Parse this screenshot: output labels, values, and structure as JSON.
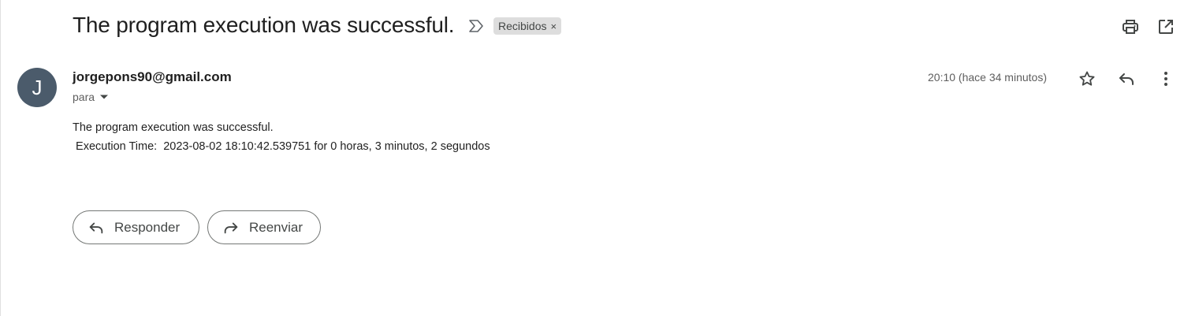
{
  "email": {
    "subject": "The program execution was successful.",
    "label_chip": {
      "text": "Recibidos",
      "remove_glyph": "×"
    },
    "sender": {
      "avatar_initial": "J",
      "avatar_color": "#4b5b6b",
      "address": "jorgepons90@gmail.com",
      "recipient_prefix": "para"
    },
    "timestamp": "20:10 (hace 34 minutos)",
    "body_lines": [
      "The program execution was successful.",
      " Execution Time:  2023-08-02 18:10:42.539751 for 0 horas, 3 minutos, 2 segundos"
    ]
  },
  "toolbar_icons": [
    "print-icon",
    "open-in-new-window-icon"
  ],
  "row_icons": [
    "star-icon",
    "reply-icon",
    "more-vert-icon"
  ],
  "actions": {
    "reply_label": "Responder",
    "forward_label": "Reenviar"
  }
}
